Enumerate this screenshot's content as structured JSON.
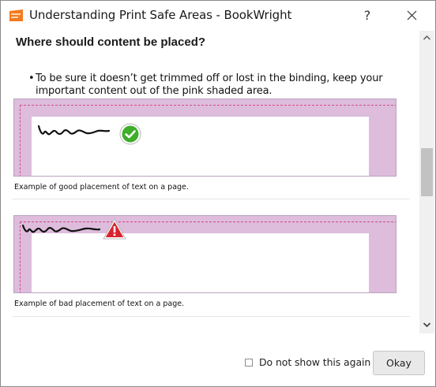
{
  "window": {
    "title": "Understanding Print Safe Areas - BookWright",
    "help_label": "?",
    "app_icon": "bookwright-logo-icon",
    "close_icon": "close-icon"
  },
  "content": {
    "heading": "Where should content be placed?",
    "bullet_text": "To be sure it doesn’t get trimmed off or lost in the binding, keep your important content out of the pink shaded area.",
    "examples": [
      {
        "caption": "Example of good placement of text on a page.",
        "status_icon": "checkmark-icon",
        "status_color": "#3fae2a"
      },
      {
        "caption": "Example of bad placement of text on a page.",
        "status_icon": "warning-icon",
        "status_color": "#d9232e"
      }
    ],
    "safe_area_color": "#ddbcdc",
    "guide_line_color": "#d8487e"
  },
  "scrollbar": {
    "up_icon": "chevron-up-icon",
    "down_icon": "chevron-down-icon"
  },
  "footer": {
    "checkbox_label": "Do not show this again",
    "checkbox_checked": false,
    "okay_label": "Okay"
  }
}
